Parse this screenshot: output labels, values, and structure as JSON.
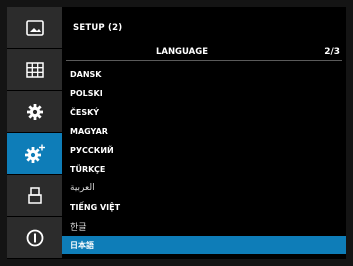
{
  "header": {
    "title": "SETUP (2)"
  },
  "section": {
    "title": "LANGUAGE",
    "page": "2/3"
  },
  "sidebar": {
    "items": [
      {
        "icon": "image-icon",
        "active": false
      },
      {
        "icon": "grid-icon",
        "active": false
      },
      {
        "icon": "gear-icon",
        "active": false
      },
      {
        "icon": "gear-plus-icon",
        "active": true
      },
      {
        "icon": "print-icon",
        "active": false
      },
      {
        "icon": "info-icon",
        "active": false
      }
    ]
  },
  "languages": [
    {
      "label": "DANSK"
    },
    {
      "label": "POLSKI"
    },
    {
      "label": "ČESKÝ"
    },
    {
      "label": "MAGYAR"
    },
    {
      "label": "РУССКИЙ"
    },
    {
      "label": "TÜRKÇE"
    },
    {
      "label": "العربية"
    },
    {
      "label": "TIẾNG VIỆT"
    },
    {
      "label": "한글"
    },
    {
      "label": "日本語",
      "selected": true
    }
  ],
  "colors": {
    "accent": "#0e7db8",
    "sidebar_bg": "#2c2c2c",
    "background": "#000000"
  }
}
